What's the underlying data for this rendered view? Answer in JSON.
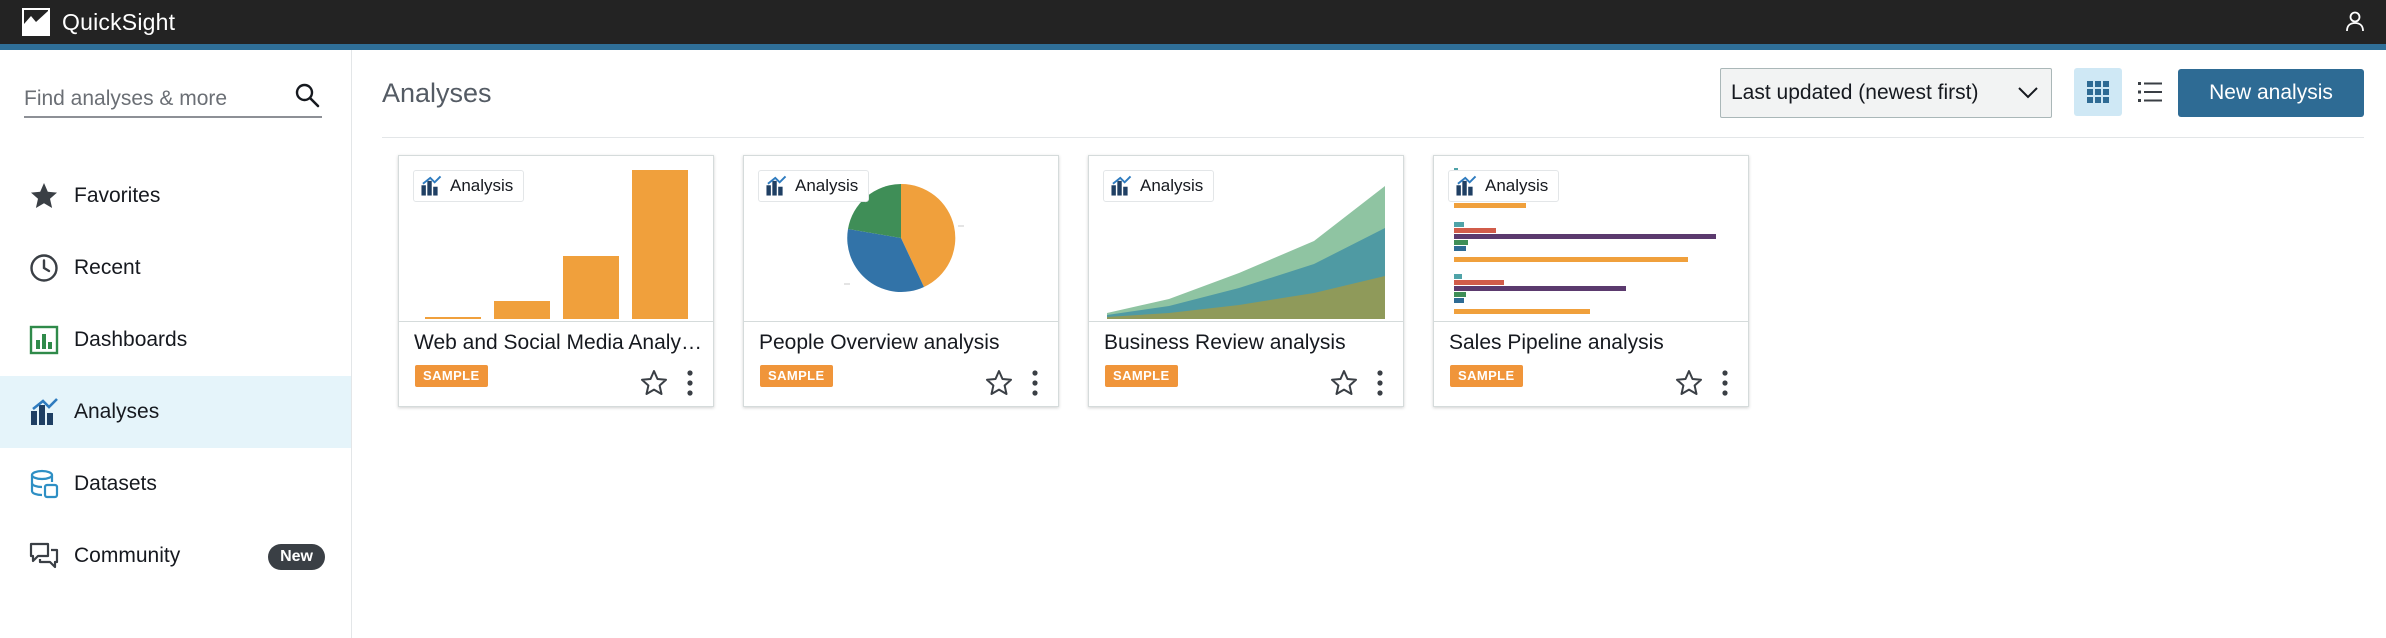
{
  "app": {
    "name": "QuickSight"
  },
  "colors": {
    "topbar": "#232323",
    "accent": "#2f6f98",
    "active_nav": "#e5f4fa",
    "primary_button": "#2e6b94",
    "sample_badge": "#f0953a"
  },
  "sidebar": {
    "search": {
      "placeholder": "Find analyses & more"
    },
    "items": [
      {
        "label": "Favorites",
        "icon": "star-icon"
      },
      {
        "label": "Recent",
        "icon": "clock-icon"
      },
      {
        "label": "Dashboards",
        "icon": "dashboard-icon"
      },
      {
        "label": "Analyses",
        "icon": "analysis-icon",
        "active": true
      },
      {
        "label": "Datasets",
        "icon": "database-icon"
      },
      {
        "label": "Community",
        "icon": "chat-icon",
        "badge": "New"
      }
    ]
  },
  "main": {
    "title": "Analyses",
    "sort": {
      "selected": "Last updated (newest first)"
    },
    "view_modes": [
      "grid-view-icon",
      "list-view-icon"
    ],
    "new_button": "New analysis",
    "cards": [
      {
        "type_label": "Analysis",
        "title": "Web and Social Media Analytics analysis",
        "badge": "SAMPLE",
        "thumbnail": "bar-chart"
      },
      {
        "type_label": "Analysis",
        "title": "People Overview analysis",
        "badge": "SAMPLE",
        "thumbnail": "pie-chart"
      },
      {
        "type_label": "Analysis",
        "title": "Business Review analysis",
        "badge": "SAMPLE",
        "thumbnail": "area-chart"
      },
      {
        "type_label": "Analysis",
        "title": "Sales Pipeline analysis",
        "badge": "SAMPLE",
        "thumbnail": "horizontal-bar-chart"
      }
    ]
  }
}
